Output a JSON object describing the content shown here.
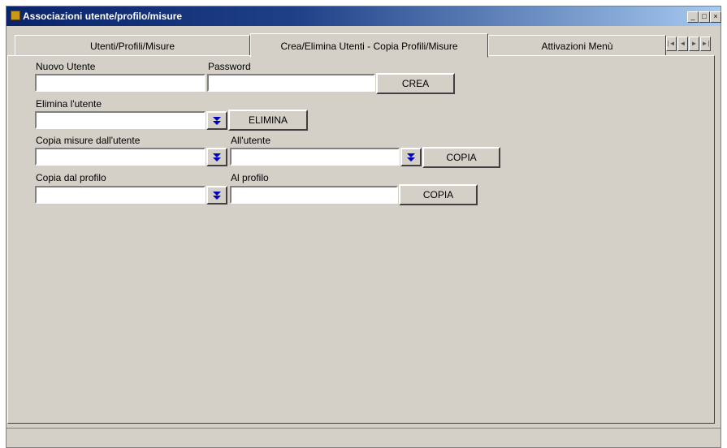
{
  "window": {
    "title": "Associazioni utente/profilo/misure",
    "controls": [
      "_",
      "□",
      "×"
    ]
  },
  "tabs": [
    {
      "label": "Utenti/Profili/Misure",
      "active": false
    },
    {
      "label": "Crea/Elimina Utenti - Copia Profili/Misure",
      "active": true
    },
    {
      "label": "Attivazioni Menù",
      "active": false
    }
  ],
  "tab_scroll": [
    "|◄",
    "◄",
    "►",
    "►|"
  ],
  "form": {
    "new_user": {
      "label": "Nuovo Utente",
      "value": ""
    },
    "password": {
      "label": "Password",
      "value": ""
    },
    "create_button": "CREA",
    "delete_user": {
      "label": "Elimina l'utente",
      "value": ""
    },
    "delete_button": "ELIMINA",
    "copy_measures_from": {
      "label": "Copia misure dall'utente",
      "value": ""
    },
    "copy_measures_to": {
      "label": "All'utente",
      "value": ""
    },
    "copy_measures_button": "COPIA",
    "copy_profile_from": {
      "label": "Copia dal profilo",
      "value": ""
    },
    "copy_profile_to": {
      "label": "Al profilo",
      "value": ""
    },
    "copy_profile_button": "COPIA"
  },
  "colors": {
    "face": "#d4d0c8",
    "titlebar_start": "#0a246a",
    "titlebar_end": "#a6caf0",
    "dropdown_arrow": "#0000c0"
  }
}
